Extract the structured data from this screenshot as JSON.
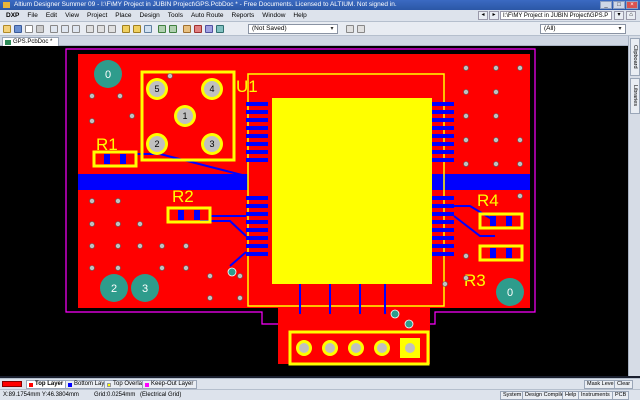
{
  "window": {
    "title": "Altium Designer Summer 09 - I:\\F\\MY Project in JUBIN Project\\GPS.PcbDoc * - Free Documents. Licensed to ALTIUM. Not signed in."
  },
  "menu": {
    "items": [
      "DXP",
      "File",
      "Edit",
      "View",
      "Project",
      "Place",
      "Design",
      "Tools",
      "Auto Route",
      "Reports",
      "Window",
      "Help"
    ],
    "path": "I:\\F\\MY Project in JUBIN Project\\GPS.P"
  },
  "toolbar": {
    "view_combo": "(Not Saved)",
    "filter_combo": "(All)"
  },
  "document_tab": {
    "label": "GPS.PcbDoc *"
  },
  "right_panel": {
    "tabs": [
      "Clipboard",
      "Libraries"
    ]
  },
  "pcb": {
    "designators": [
      "U1",
      "R1",
      "R2",
      "R3",
      "R4"
    ],
    "pad_numbers": [
      "5",
      "4",
      "1",
      "2",
      "3",
      "2",
      "3",
      "0",
      "0"
    ],
    "colors": {
      "board": "#000000",
      "top_layer": "#ff0000",
      "bottom_layer": "#0000ff",
      "top_overlay": "#ffff00",
      "keep_out": "#ff00ff",
      "pad": "#c0c0c0",
      "mounting_hole": "#2e9c8c"
    }
  },
  "layers": {
    "tabs": [
      {
        "label": "Top Layer",
        "color": "#ff0000",
        "active": true
      },
      {
        "label": "Bottom Layer",
        "color": "#0000ff",
        "active": false
      },
      {
        "label": "Top Overlay",
        "color": "#ffff00",
        "active": false
      },
      {
        "label": "Keep-Out Layer",
        "color": "#ff00ff",
        "active": false
      }
    ],
    "right_buttons": [
      "Mask Level",
      "Clear"
    ]
  },
  "status": {
    "coords": "X:89.1754mm Y:46.3804mm",
    "grid": "Grid:0.0254mm",
    "grid_type": "(Electrical Grid)",
    "buttons": [
      "System",
      "Design Compiler",
      "Help",
      "Instruments",
      "PCB"
    ]
  }
}
